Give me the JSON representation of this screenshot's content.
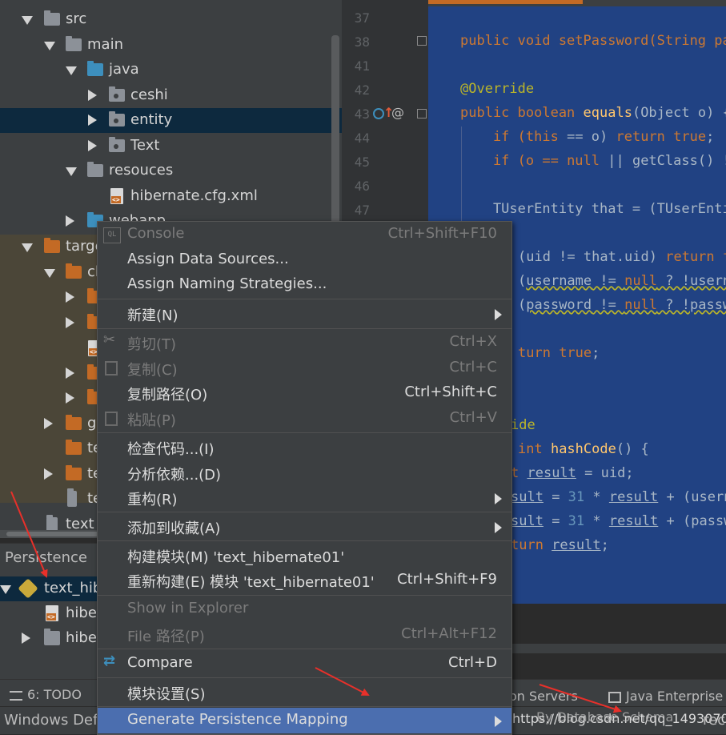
{
  "tree": {
    "items": [
      {
        "label": "src"
      },
      {
        "label": "main"
      },
      {
        "label": "java"
      },
      {
        "label": "ceshi"
      },
      {
        "label": "entity"
      },
      {
        "label": "Text"
      },
      {
        "label": "resouces"
      },
      {
        "label": "hibernate.cfg.xml"
      },
      {
        "label": "webapp"
      },
      {
        "label": "target"
      },
      {
        "label": "cl"
      },
      {
        "label": "g"
      },
      {
        "label": "te"
      },
      {
        "label": "te"
      },
      {
        "label": "te"
      },
      {
        "label": "text_"
      }
    ]
  },
  "persistence": {
    "title": "Persistence",
    "items": [
      {
        "label": "text_hib"
      },
      {
        "label": "hibe"
      },
      {
        "label": "hibe"
      }
    ]
  },
  "editor": {
    "line_numbers": [
      "37",
      "38",
      "41",
      "42",
      "43",
      "44",
      "45",
      "46",
      "47"
    ],
    "code": {
      "l38": "public void setPassword(String pa",
      "l42": "@Override",
      "l43a": "public boolean ",
      "l43b": "equals",
      "l43c": "(Object o) {",
      "l44a": "    if (",
      "l44b": "this",
      "l44c": " == o) ",
      "l44d": "return true",
      "l44e": ";",
      "l45a": "    if (o == ",
      "l45b": "null",
      "l45c": " || getClass() !",
      "l47": "    TUserEntity that = (TUserEnti",
      "l49a": "(uid != that.uid) ",
      "l49b": "return f",
      "l50a": "(",
      "l50b": "username",
      "l50c": " != ",
      "l50d": "null",
      "l50e": " ? !usern",
      "l51a": "(",
      "l51b": "password",
      "l51c": " != ",
      "l51d": "null",
      "l51e": " ? !passw",
      "l53a": "turn ",
      "l53b": "true",
      "l53c": ";",
      "l56": "ide",
      "l57a": "int ",
      "l57b": "hashCode",
      "l57c": "() {",
      "l58a": "t ",
      "l58b": "result",
      "l58c": " = uid;",
      "l59a": "sult",
      "l59b": " = ",
      "l59c": "31",
      "l59d": " * ",
      "l59e": "result",
      "l59f": " + (usern",
      "l60a": "sult",
      "l60b": " = ",
      "l60c": "31",
      "l60d": " * ",
      "l60e": "result",
      "l60f": " + (passw",
      "l61a": "turn ",
      "l61b": "result",
      "l61c": ";"
    }
  },
  "context_menu": {
    "items": [
      {
        "label": "Console",
        "shortcut": "Ctrl+Shift+F10"
      },
      {
        "label": "Assign Data Sources...",
        "shortcut": ""
      },
      {
        "label": "Assign Naming Strategies...",
        "shortcut": ""
      },
      {
        "label": "新建(N)",
        "shortcut": ""
      },
      {
        "label": "剪切(T)",
        "shortcut": "Ctrl+X"
      },
      {
        "label": "复制(C)",
        "shortcut": "Ctrl+C"
      },
      {
        "label": "复制路径(O)",
        "shortcut": "Ctrl+Shift+C"
      },
      {
        "label": "粘贴(P)",
        "shortcut": "Ctrl+V"
      },
      {
        "label": "检查代码...(I)",
        "shortcut": ""
      },
      {
        "label": "分析依赖...(D)",
        "shortcut": ""
      },
      {
        "label": "重构(R)",
        "shortcut": ""
      },
      {
        "label": "添加到收藏(A)",
        "shortcut": ""
      },
      {
        "label": "构建模块(M) 'text_hibernate01'",
        "shortcut": ""
      },
      {
        "label": "重新构建(E) 模块 'text_hibernate01'",
        "shortcut": "Ctrl+Shift+F9"
      },
      {
        "label": "Show in Explorer",
        "shortcut": ""
      },
      {
        "label": "File 路径(P)",
        "shortcut": "Ctrl+Alt+F12"
      },
      {
        "label": "Compare",
        "shortcut": "Ctrl+D"
      },
      {
        "label": "模块设置(S)",
        "shortcut": ""
      },
      {
        "label": "Generate Persistence Mapping",
        "shortcut": ""
      }
    ]
  },
  "toolbar": {
    "todo_label": "6: TODO",
    "servers_label": "on Servers",
    "java_enterprise_label": "Java Enterprise"
  },
  "status": {
    "left_text": "Windows Defe",
    "right_text": "https://blog.csdn.net/qq_14930709",
    "overlay_text": "By Database Schema",
    "tail_text": "rec"
  },
  "colors": {
    "selection": "#0d293e",
    "menu_highlight": "#4b6eaf",
    "code_selection": "#214283",
    "keyword": "#cc7832",
    "annotation": "#bbb529",
    "arrow": "#e8302a"
  }
}
